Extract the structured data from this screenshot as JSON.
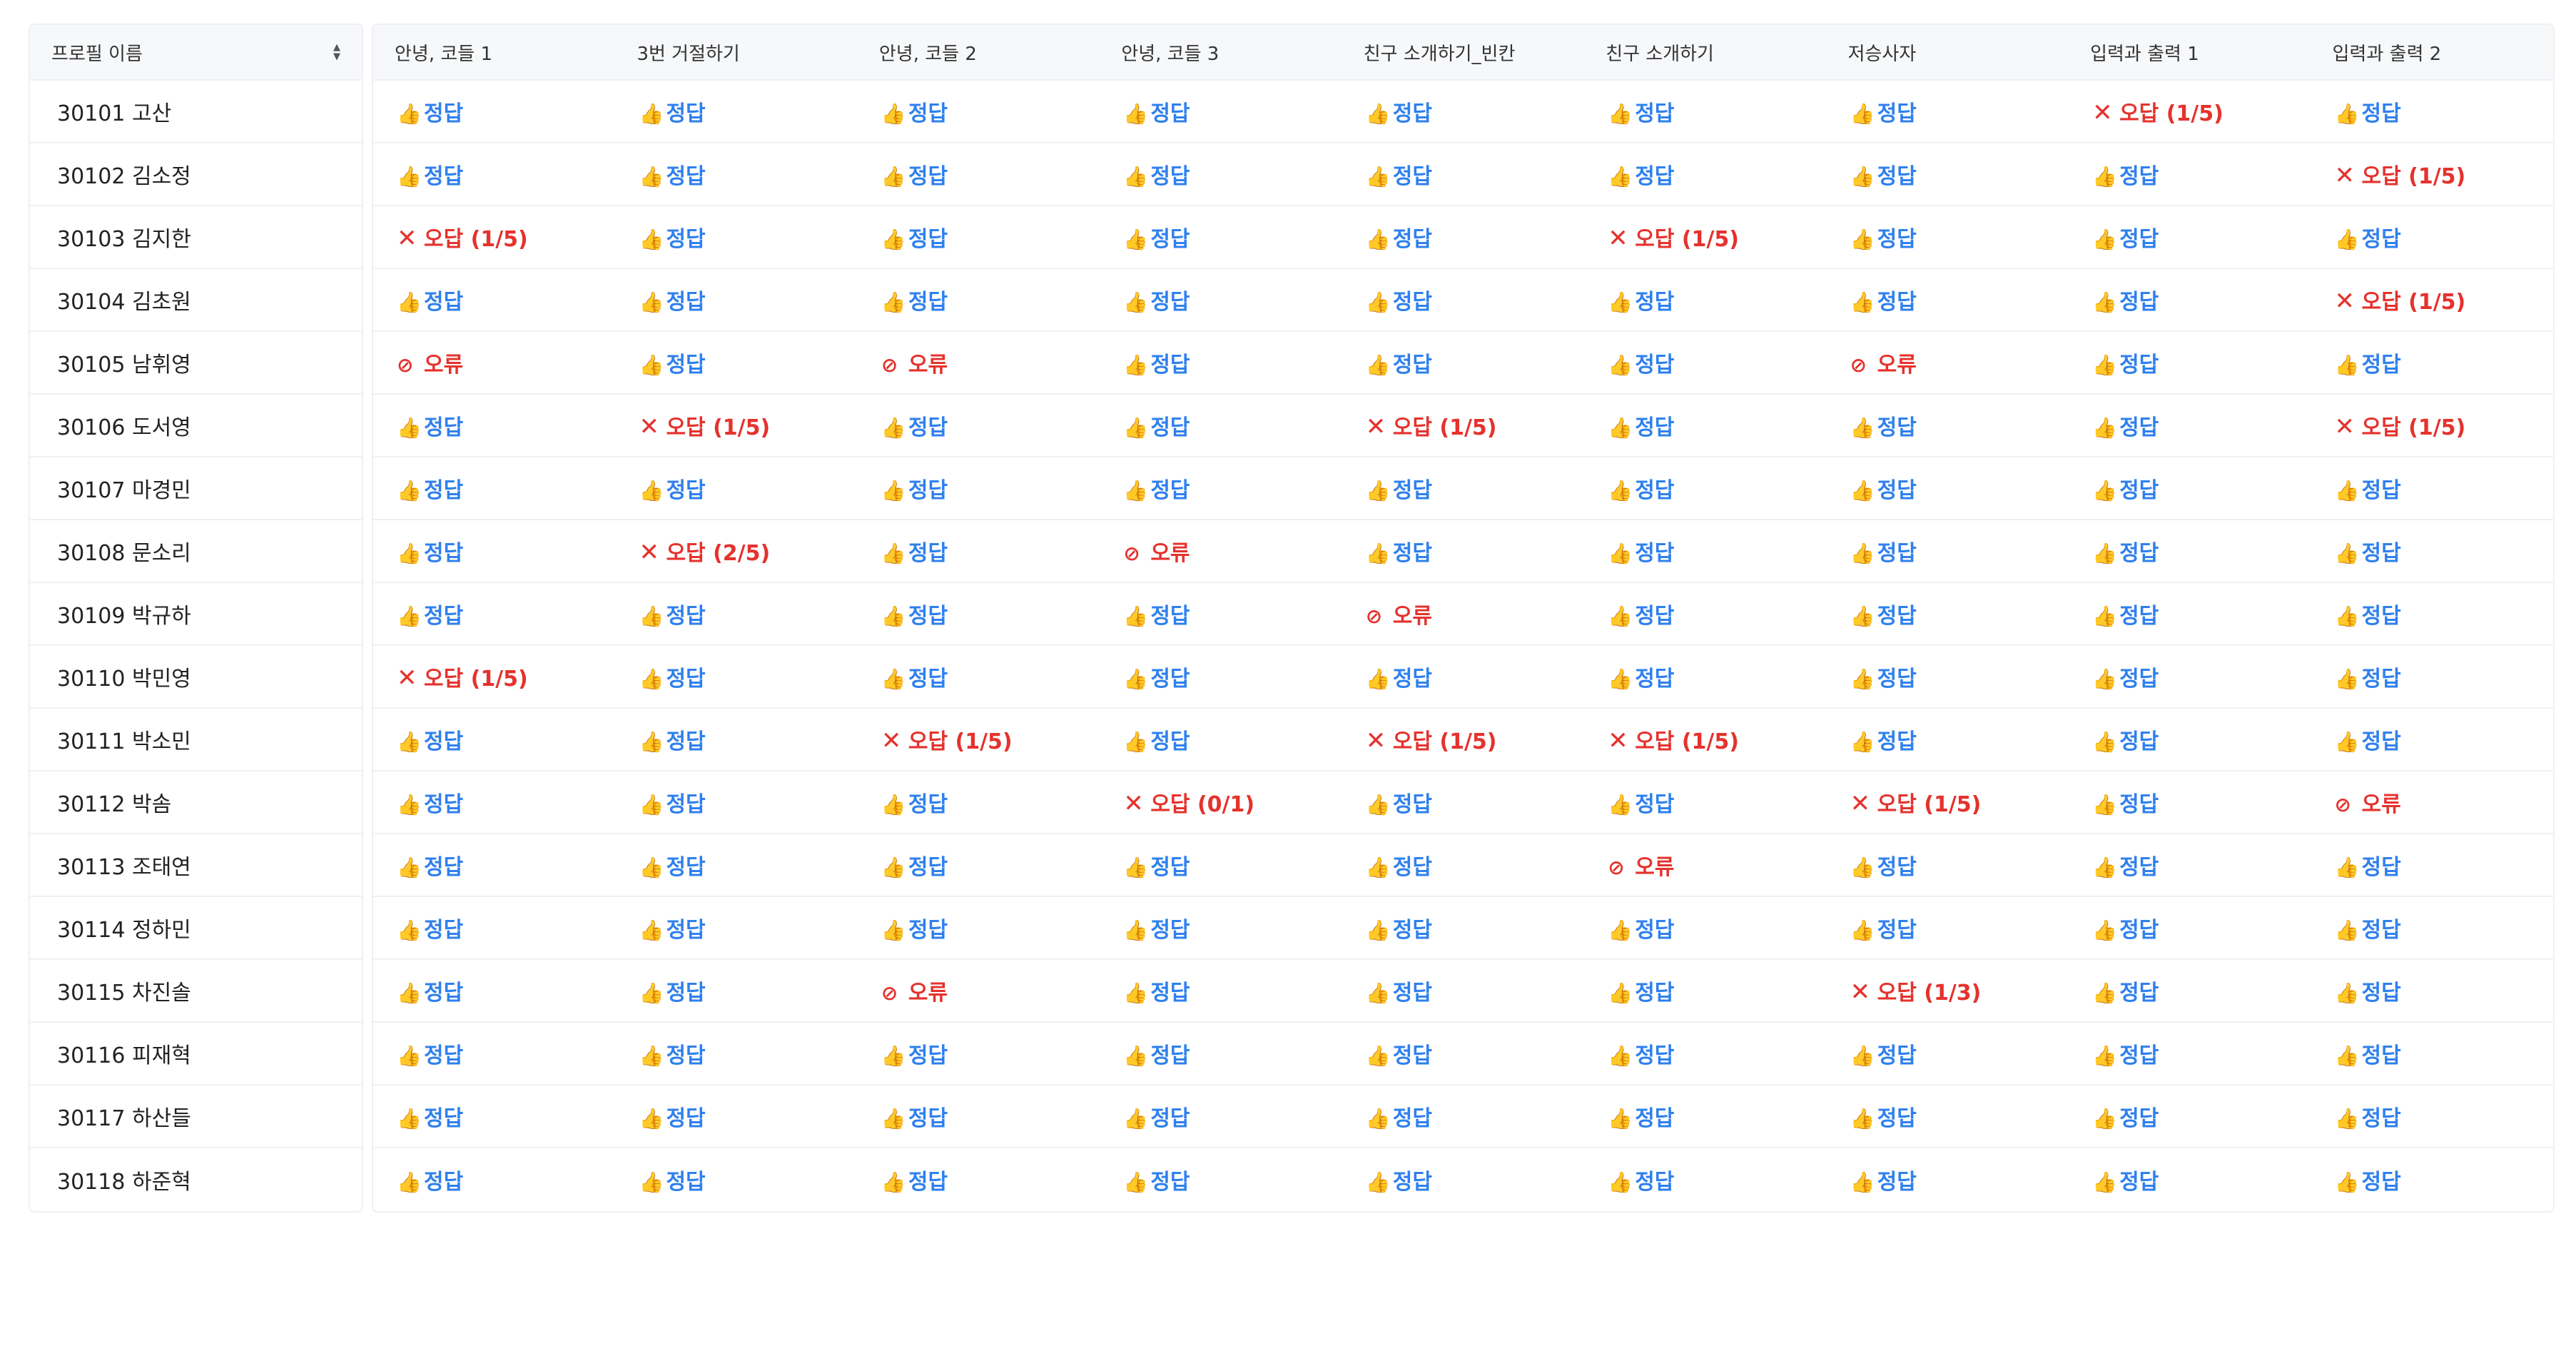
{
  "header": {
    "name_col": "프로필 이름",
    "columns": [
      "안녕, 코들 1",
      "3번 거절하기",
      "안녕, 코들 2",
      "안녕, 코들 3",
      "친구 소개하기_빈칸",
      "친구 소개하기",
      "저승사자",
      "입력과 출력 1",
      "입력과 출력 2"
    ]
  },
  "labels": {
    "ok": "정답",
    "error": "오류"
  },
  "icons": {
    "ok": "thumbs-up-icon",
    "wrong": "x-mark-icon",
    "error": "no-entry-icon"
  },
  "colors": {
    "ok": "#2f80ed",
    "wrong": "#e5322d",
    "error": "#e5322d"
  },
  "rows": [
    {
      "name": "30101 고산",
      "cells": [
        "정답",
        "정답",
        "정답",
        "정답",
        "정답",
        "정답",
        "정답",
        "오답 (1/5)",
        "정답"
      ]
    },
    {
      "name": "30102 김소정",
      "cells": [
        "정답",
        "정답",
        "정답",
        "정답",
        "정답",
        "정답",
        "정답",
        "정답",
        "오답 (1/5)"
      ]
    },
    {
      "name": "30103 김지한",
      "cells": [
        "오답 (1/5)",
        "정답",
        "정답",
        "정답",
        "정답",
        "오답 (1/5)",
        "정답",
        "정답",
        "정답"
      ]
    },
    {
      "name": "30104 김초원",
      "cells": [
        "정답",
        "정답",
        "정답",
        "정답",
        "정답",
        "정답",
        "정답",
        "정답",
        "오답 (1/5)"
      ]
    },
    {
      "name": "30105 남휘영",
      "cells": [
        "오류",
        "정답",
        "오류",
        "정답",
        "정답",
        "정답",
        "오류",
        "정답",
        "정답"
      ]
    },
    {
      "name": "30106 도서영",
      "cells": [
        "정답",
        "오답 (1/5)",
        "정답",
        "정답",
        "오답 (1/5)",
        "정답",
        "정답",
        "정답",
        "오답 (1/5)"
      ]
    },
    {
      "name": "30107 마경민",
      "cells": [
        "정답",
        "정답",
        "정답",
        "정답",
        "정답",
        "정답",
        "정답",
        "정답",
        "정답"
      ]
    },
    {
      "name": "30108 문소리",
      "cells": [
        "정답",
        "오답 (2/5)",
        "정답",
        "오류",
        "정답",
        "정답",
        "정답",
        "정답",
        "정답"
      ]
    },
    {
      "name": "30109 박규하",
      "cells": [
        "정답",
        "정답",
        "정답",
        "정답",
        "오류",
        "정답",
        "정답",
        "정답",
        "정답"
      ]
    },
    {
      "name": "30110 박민영",
      "cells": [
        "오답 (1/5)",
        "정답",
        "정답",
        "정답",
        "정답",
        "정답",
        "정답",
        "정답",
        "정답"
      ]
    },
    {
      "name": "30111 박소민",
      "cells": [
        "정답",
        "정답",
        "오답 (1/5)",
        "정답",
        "오답 (1/5)",
        "오답 (1/5)",
        "정답",
        "정답",
        "정답"
      ]
    },
    {
      "name": "30112 박솜",
      "cells": [
        "정답",
        "정답",
        "정답",
        "오답 (0/1)",
        "정답",
        "정답",
        "오답 (1/5)",
        "정답",
        "오류"
      ]
    },
    {
      "name": "30113 조태연",
      "cells": [
        "정답",
        "정답",
        "정답",
        "정답",
        "정답",
        "오류",
        "정답",
        "정답",
        "정답"
      ]
    },
    {
      "name": "30114 정하민",
      "cells": [
        "정답",
        "정답",
        "정답",
        "정답",
        "정답",
        "정답",
        "정답",
        "정답",
        "정답"
      ]
    },
    {
      "name": "30115 차진솔",
      "cells": [
        "정답",
        "정답",
        "오류",
        "정답",
        "정답",
        "정답",
        "오답 (1/3)",
        "정답",
        "정답"
      ]
    },
    {
      "name": "30116 피재혁",
      "cells": [
        "정답",
        "정답",
        "정답",
        "정답",
        "정답",
        "정답",
        "정답",
        "정답",
        "정답"
      ]
    },
    {
      "name": "30117 하산들",
      "cells": [
        "정답",
        "정답",
        "정답",
        "정답",
        "정답",
        "정답",
        "정답",
        "정답",
        "정답"
      ]
    },
    {
      "name": "30118 하준혁",
      "cells": [
        "정답",
        "정답",
        "정답",
        "정답",
        "정답",
        "정답",
        "정답",
        "정답",
        "정답"
      ]
    }
  ]
}
